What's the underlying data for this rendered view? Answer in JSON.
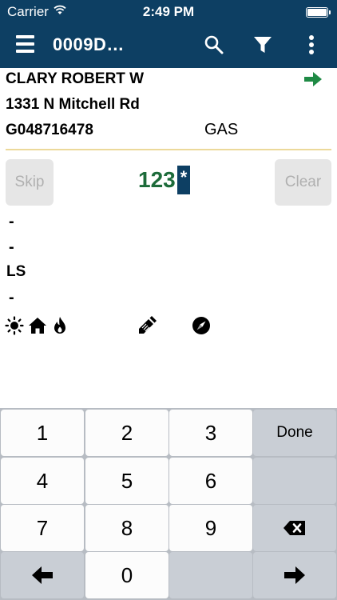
{
  "status_bar": {
    "carrier": "Carrier",
    "time": "2:49 PM"
  },
  "nav": {
    "title": "0009D…"
  },
  "account": {
    "name": "CLARY ROBERT W",
    "address": "1331 N Mitchell Rd",
    "meter_id": "G048716478",
    "service": "GAS"
  },
  "reading": {
    "skip_label": "Skip",
    "clear_label": "Clear",
    "value": "123",
    "cursor": "*"
  },
  "fields": [
    "-",
    "-",
    "LS",
    "-"
  ],
  "keypad": {
    "keys": [
      "1",
      "2",
      "3",
      "4",
      "5",
      "6",
      "7",
      "8",
      "9",
      "0"
    ],
    "done_label": "Done"
  },
  "colors": {
    "nav_bar": "#0d3f63",
    "reading": "#1d6b3a",
    "arrow": "#1f8a45",
    "divider": "#ecd99a"
  }
}
